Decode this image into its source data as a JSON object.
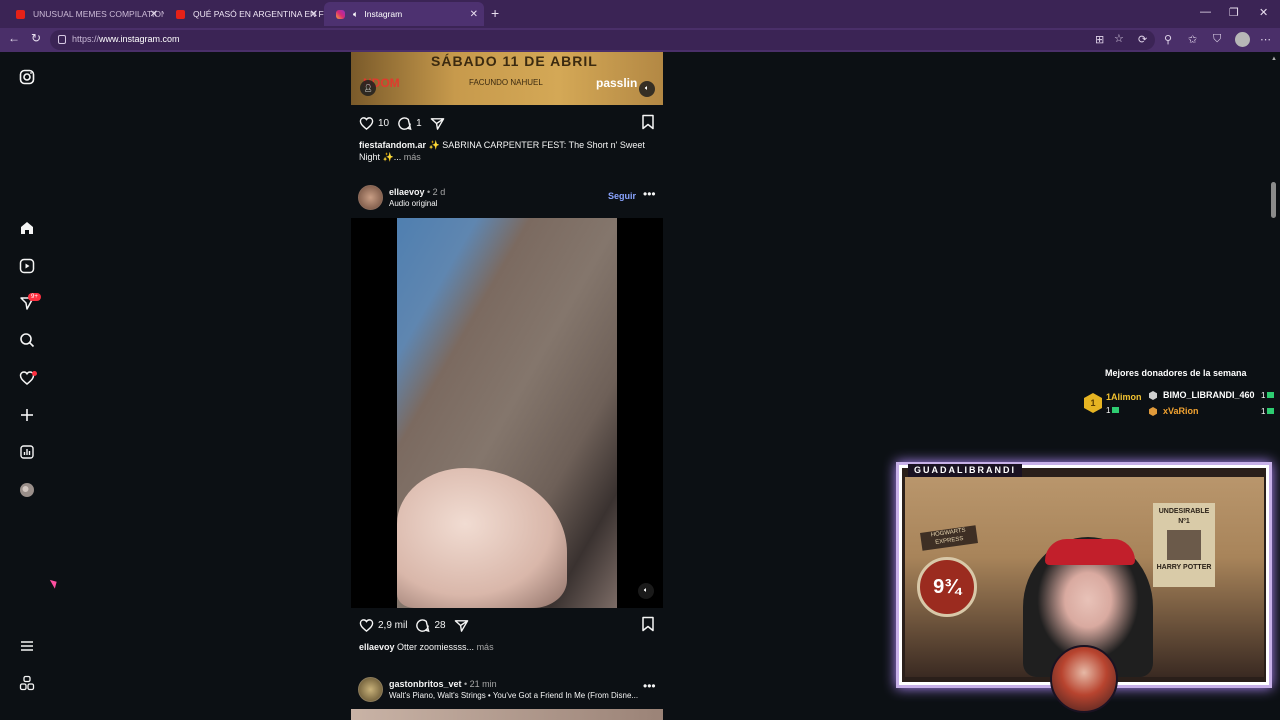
{
  "browser": {
    "tabs": [
      {
        "title": "UNUSUAL MEMES COMPILATION",
        "icon": "youtube-icon",
        "active": false
      },
      {
        "title": "QUÉ PASÓ EN ARGENTINA EN FEB",
        "icon": "youtube-icon",
        "active": false
      },
      {
        "title": "Instagram",
        "icon": "instagram-icon",
        "active": true
      }
    ],
    "url_protocol": "https://",
    "url_host": "www.instagram.com"
  },
  "sidebar": {
    "notifications_badge": "9+"
  },
  "post1": {
    "banner_text": "SÁBADO 11 DE ABRIL",
    "banner_sub": "FACUNDO NAHUEL",
    "banner_brand_left": "NDOM",
    "banner_brand_right": "passlin",
    "likes": "10",
    "comments": "1",
    "caption_user": "fiestafandom.ar",
    "caption_text": " ✨ SABRINA CARPENTER FEST: The Short n' Sweet Night ✨...",
    "caption_more": " más"
  },
  "post2": {
    "username": "ellaevoy",
    "time": " • 2 d",
    "subtitle": "Audio original",
    "follow_label": "Seguir",
    "likes": "2,9 mil",
    "comments": "28",
    "caption_user": "ellaevoy",
    "caption_text": " Otter zoomiessss...",
    "caption_more": " más"
  },
  "post3": {
    "username": "gastonbritos_vet",
    "time": " • 21 min",
    "subtitle": "Walt's Piano, Walt's Strings • You've Got a Friend In Me (From Disne..."
  },
  "donors": {
    "title": "Mejores donadores de la semana",
    "rank_number": "1",
    "list": [
      {
        "name": "1Alimon",
        "count": "1"
      },
      {
        "name": "BIMO_LIBRANDI_460",
        "count": "1"
      },
      {
        "name": "xVaRion",
        "count": "1"
      }
    ]
  },
  "stream": {
    "channel_name": "GUADALIBRANDI",
    "poster_title": "UNDESIRABLE",
    "poster_number": "Nº1",
    "poster_name": "HARRY POTTER",
    "platform_sign": "9¾",
    "hogwarts_sign": "HOGWARTS EXPRESS"
  },
  "colors": {
    "tab_bar": "#3b2455",
    "address_bar": "#4a2f69",
    "ig_background": "#0c1014",
    "follow_blue": "#8aa4ff",
    "notification_red": "#ff3040"
  }
}
